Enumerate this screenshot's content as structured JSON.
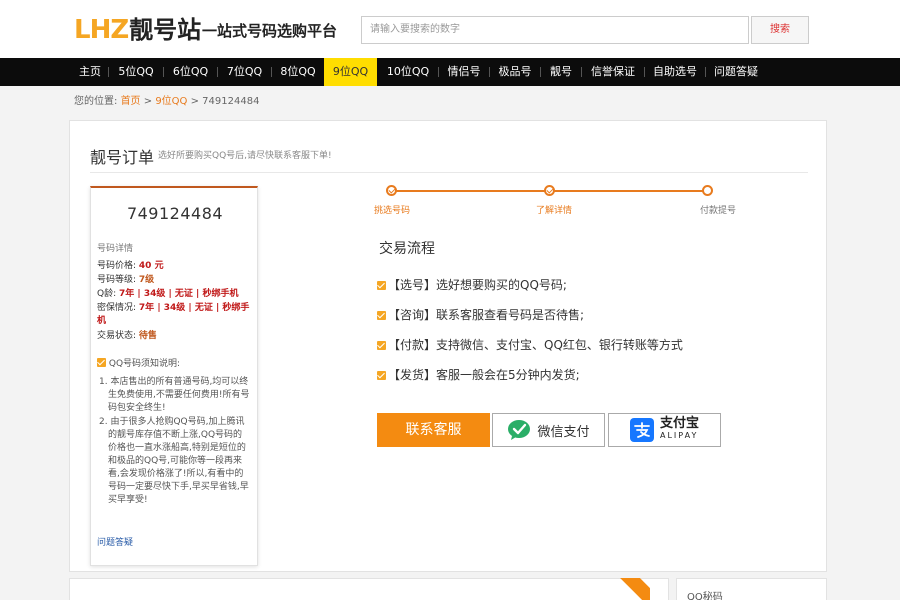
{
  "header": {
    "logo_latin": "LHZ",
    "logo_cn": "靓号站",
    "slogan": "一站式号码选购平台",
    "search_placeholder": "请输入要搜索的数字",
    "search_button": "搜索"
  },
  "nav": {
    "items": [
      "主页",
      "5位QQ",
      "6位QQ",
      "7位QQ",
      "8位QQ",
      "9位QQ",
      "10位QQ",
      "情侣号",
      "极品号",
      "靓号",
      "信誉保证",
      "自助选号",
      "问题答疑"
    ],
    "active_index": 5
  },
  "breadcrumb": {
    "prefix": "您的位置:",
    "home": "首页",
    "sep1": " > ",
    "category": "9位QQ",
    "sep2": " > ",
    "current": "749124484"
  },
  "order": {
    "title": "靓号订单",
    "subtitle": "选好所要购买QQ号后,请尽快联系客服下单!"
  },
  "card": {
    "number": "749124484",
    "section_label": "号码详情",
    "price_label": "号码价格:",
    "price_value": "40 元",
    "level_label": "号码等级:",
    "level_value": "7级",
    "age_label": "Q龄:",
    "age_value": "7年 | 34级 | 无证 | 秒绑手机",
    "security_label": "密保情况:",
    "security_value": "7年 | 34级 | 无证 | 秒绑手机",
    "status_label": "交易状态:",
    "status_value": "待售",
    "notice_head": "QQ号码须知说明:",
    "notice_1": "1. 本店售出的所有普通号码,均可以终生免费使用,不需要任何费用!所有号码包安全终生!",
    "notice_2": "2. 由于很多人抢购QQ号码,加上腾讯的靓号库存值不断上涨,QQ号码的价格也一直水涨船高,特别是短位的和极品的QQ号,可能你等一段再来看,会发现价格涨了!所以,有看中的号码一定要尽快下手,早买早省钱,早买早享受!",
    "faq": "问题答疑"
  },
  "steps": {
    "s1": "挑选号码",
    "s2": "了解详情",
    "s3": "付款提号"
  },
  "flow": {
    "title": "交易流程",
    "r1": "【选号】选好想要购买的QQ号码;",
    "r2": "【咨询】联系客服查看号码是否待售;",
    "r3": "【付款】支持微信、支付宝、QQ红包、银行转账等方式",
    "r4": "【发货】客服一般会在5分钟内发货;"
  },
  "buttons": {
    "service": "联系客服",
    "wechat": "微信支付",
    "alipay_cn": "支付宝",
    "alipay_en": "ALIPAY"
  },
  "bottom": {
    "right_label": "QQ秘码"
  },
  "colors": {
    "accent": "#f48b11",
    "nav_bg": "#0c0c0c",
    "nav_active": "#ffdd00",
    "price_red": "#c01818"
  }
}
